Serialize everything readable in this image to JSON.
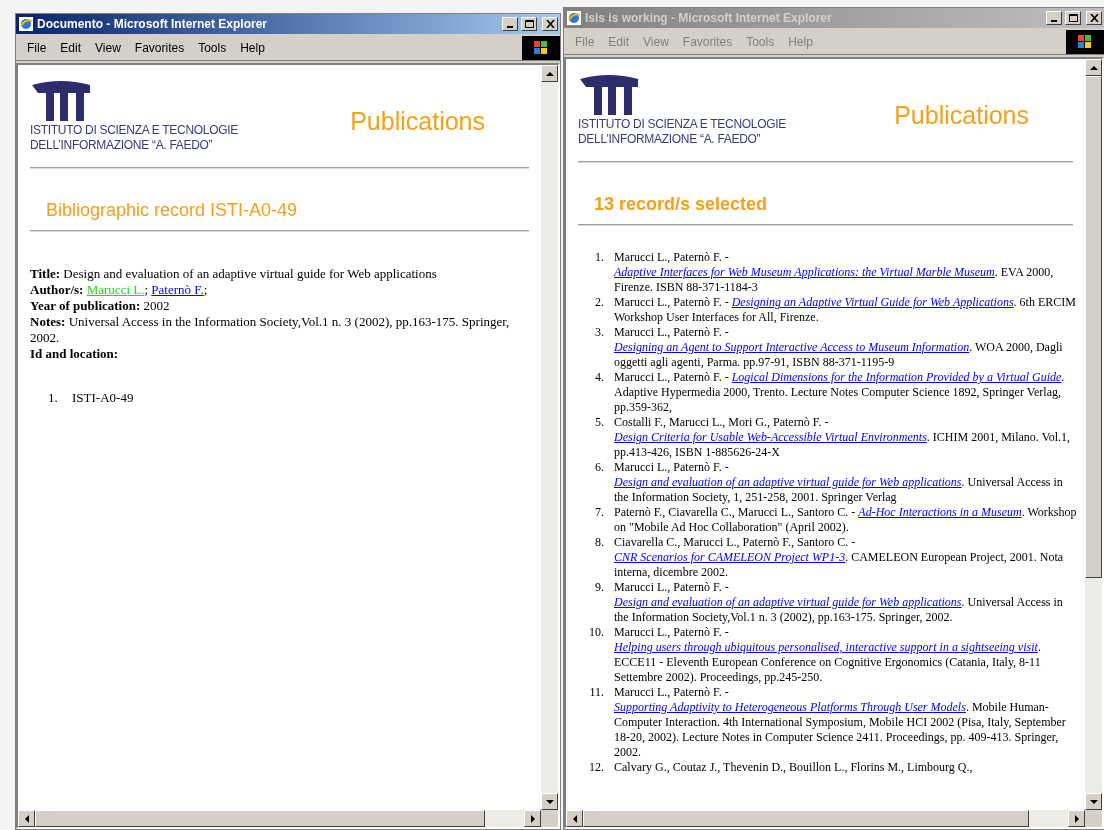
{
  "windows": [
    {
      "kind": "record",
      "title": "Documento - Microsoft Internet Explorer",
      "active": true,
      "menu": [
        "File",
        "Edit",
        "View",
        "Favorites",
        "Tools",
        "Help"
      ],
      "logo_lines": [
        "ISTITUTO DI SCIENZA E TECNOLOGIE",
        "DELL’INFORMAZIONE “A. FAEDO”"
      ],
      "page_title": "Publications",
      "heading": "Bibliographic record ISTI-A0-49",
      "fields": [
        {
          "label": "Title:",
          "parts": [
            {
              "kind": "text",
              "text": "Design and evaluation of an adaptive virtual guide for Web applications"
            }
          ]
        },
        {
          "label": "Author/s:",
          "parts": [
            {
              "kind": "link",
              "text": "Marucci L.",
              "color": "#33cc33"
            },
            {
              "kind": "text",
              "text": ";"
            },
            {
              "kind": "link",
              "text": "Paternò F.",
              "color": "#0000ff"
            },
            {
              "kind": "text",
              "text": ";"
            }
          ]
        },
        {
          "label": "Year of publication:",
          "parts": [
            {
              "kind": "text",
              "text": "2002"
            }
          ]
        },
        {
          "label": "Notes:",
          "parts": [
            {
              "kind": "text",
              "text": "Universal Access in the Information Society,Vol.1 n. 3 (2002), pp.163-175. Springer, 2002."
            }
          ]
        },
        {
          "label": "Id and location:"
        }
      ],
      "locations": [
        {
          "number": "1.",
          "text": "ISTI-A0-49"
        }
      ]
    },
    {
      "kind": "list",
      "title": "Isis is working - Microsoft Internet Explorer",
      "active": false,
      "menu": [
        "File",
        "Edit",
        "View",
        "Favorites",
        "Tools",
        "Help"
      ],
      "logo_lines": [
        "ISTITUTO DI SCIENZA E TECNOLOGIE",
        "DELL’INFORMAZIONE “A. FAEDO”"
      ],
      "page_title": "Publications",
      "heading": "13 record/s selected",
      "records": [
        {
          "number": "1.",
          "authors": "Marucci L., Paternò F. -",
          "title": "Adaptive Interfaces for Web Museum Applications: the Virtual Marble Museum",
          "rest": ". EVA 2000, Firenze. ISBN 88-371-1184-3"
        },
        {
          "number": "2.",
          "authors": "Marucci L., Paternò F. -",
          "title": "Designing an Adaptive Virtual Guide for Web Applications",
          "rest": ". 6th ERCIM Workshop User Interfaces for All, Firenze."
        },
        {
          "number": "3.",
          "authors": "Marucci L., Paternò F. -",
          "title": "Designing an Agent to Support Interactive Access to Museum Information",
          "rest": ". WOA 2000, Dagli oggetti agli agenti, Parma. pp.97-91, ISBN 88-371-1195-9"
        },
        {
          "number": "4.",
          "authors": "Marucci L., Paternò F. -",
          "title": "Logical Dimensions for the Information Provided by a Virtual Guide",
          "rest": ". Adaptive Hypermedia 2000, Trento. Lecture Notes Computer Science 1892, Springer Verlag, pp.359-362,"
        },
        {
          "number": "5.",
          "authors": "Costalli F., Marucci L., Mori G., Paternò F. -",
          "title": "Design Criteria for Usable Web-Accessible Virtual Environments",
          "rest": ". ICHIM 2001, Milano. Vol.1, pp.413-426, ISBN 1-885626-24-X"
        },
        {
          "number": "6.",
          "authors": "Marucci L., Paternò F. -",
          "title": "Design and evaluation of an adaptive virtual guide for Web applications",
          "rest": ". Universal Access in the Information Society, 1, 251-258, 2001. Springer Verlag"
        },
        {
          "number": "7.",
          "authors": "Paternò F., Ciavarella C., Marucci L., Santoro C. -",
          "title": "Ad-Hoc Interactions in a Museum",
          "rest": ". Workshop on \"Mobile Ad Hoc Collaboration\" (April 2002)."
        },
        {
          "number": "8.",
          "authors": "Ciavarella C., Marucci L., Paternò F., Santoro C. -",
          "title": "CNR Scenarios for CAMELEON Project WP1-3",
          "rest": ". CAMELEON European Project, 2001. Nota interna, dicembre 2002."
        },
        {
          "number": "9.",
          "authors": "Marucci L., Paternò F. -",
          "title": "Design and evaluation of an adaptive virtual guide for Web applications",
          "rest": ". Universal Access in the Information Society,Vol.1 n. 3 (2002), pp.163-175. Springer, 2002."
        },
        {
          "number": "10.",
          "authors": "Marucci L., Paternò F. -",
          "title": "Helping users through ubiquitous personalised, interactive support in a sightseeing visit",
          "rest": ". ECCE11 - Eleventh European Conference on Cognitive Ergonomics (Catania, Italy, 8-11 Settembre 2002). Proceedings, pp.245-250."
        },
        {
          "number": "11.",
          "authors": "Marucci L., Paternò F. -",
          "title": "Supporting Adaptivity to Heterogeneous Platforms Through User Models",
          "rest": ". Mobile Human-Computer Interaction. 4th International Symposium, Mobile HCI 2002 (Pisa, Italy, September 18-20, 2002). Lecture Notes in Computer Science 2411. Proceedings, pp. 409-413. Springer, 2002."
        },
        {
          "number": "12.",
          "authors": "Calvary G., Coutaz J., Thevenin D., Bouillon L., Florins M., Limbourg Q.,"
        }
      ]
    }
  ]
}
